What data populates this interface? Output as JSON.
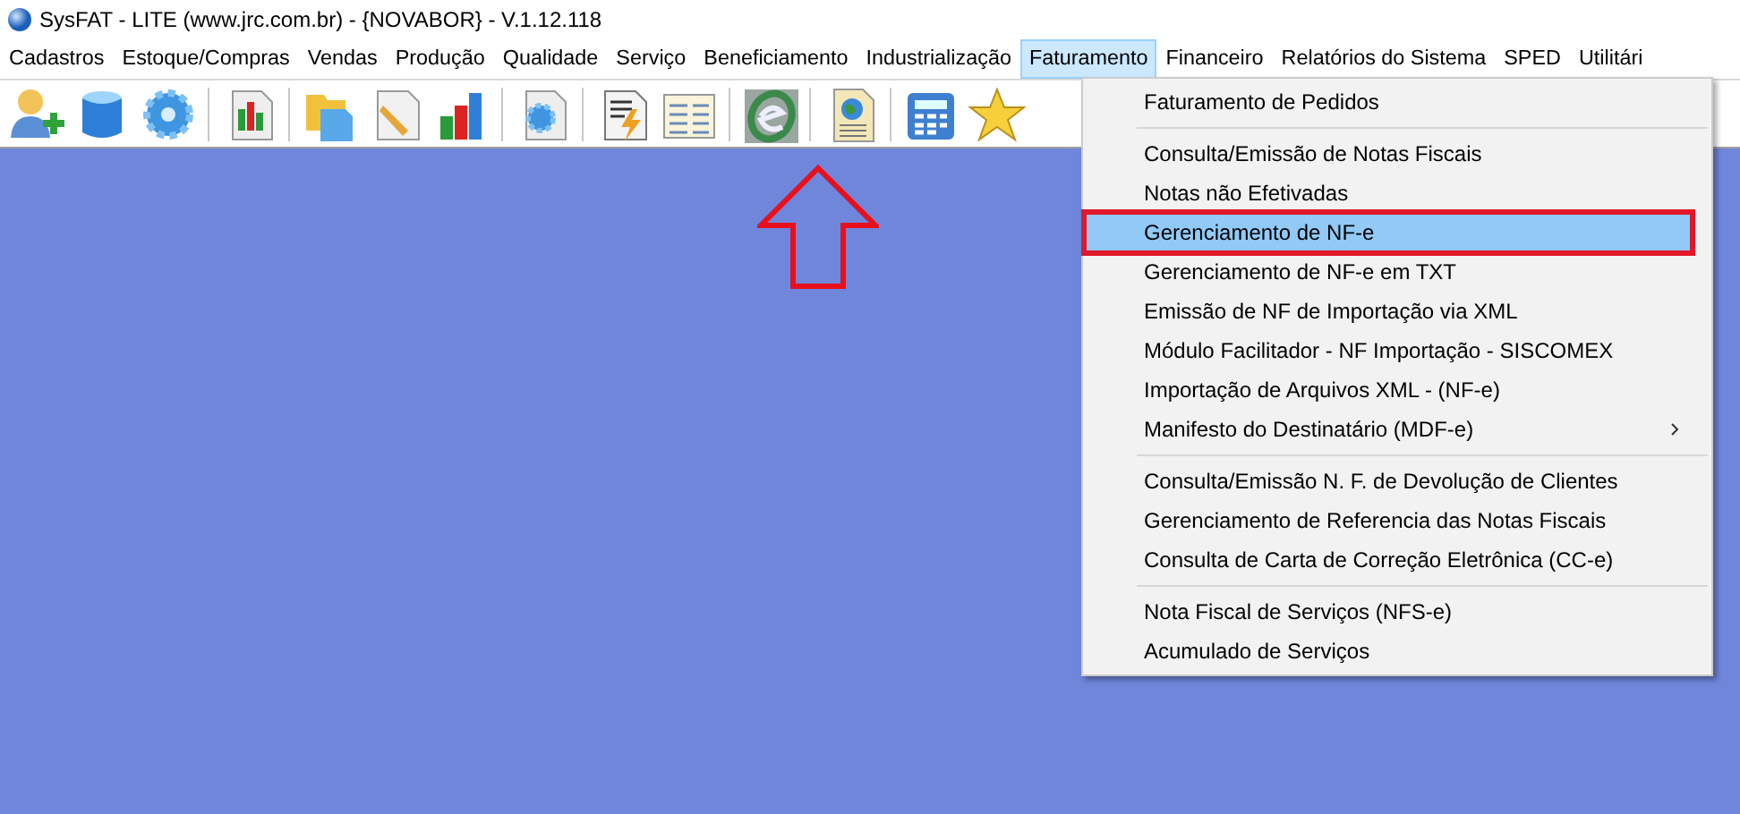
{
  "window": {
    "title": "SysFAT - LITE (www.jrc.com.br) - {NOVABOR} - V.1.12.118"
  },
  "menu_bar": [
    {
      "label": "Cadastros",
      "selected": false
    },
    {
      "label": "Estoque/Compras",
      "selected": false
    },
    {
      "label": "Vendas",
      "selected": false
    },
    {
      "label": "Produção",
      "selected": false
    },
    {
      "label": "Qualidade",
      "selected": false
    },
    {
      "label": "Serviço",
      "selected": false
    },
    {
      "label": "Beneficiamento",
      "selected": false
    },
    {
      "label": "Industrialização",
      "selected": false
    },
    {
      "label": "Faturamento",
      "selected": true
    },
    {
      "label": "Financeiro",
      "selected": false
    },
    {
      "label": "Relatórios do Sistema",
      "selected": false
    },
    {
      "label": "SPED",
      "selected": false
    },
    {
      "label": "Utilitári",
      "selected": false
    }
  ],
  "dropdown": [
    {
      "kind": "item",
      "label": "Faturamento de Pedidos",
      "selected": false,
      "submenu": false
    },
    {
      "kind": "separator"
    },
    {
      "kind": "item",
      "label": "Consulta/Emissão de Notas Fiscais",
      "selected": false,
      "submenu": false
    },
    {
      "kind": "item",
      "label": "Notas não Efetivadas",
      "selected": false,
      "submenu": false
    },
    {
      "kind": "item",
      "label": "Gerenciamento de NF-e",
      "selected": true,
      "submenu": false
    },
    {
      "kind": "item",
      "label": "Gerenciamento de NF-e em TXT",
      "selected": false,
      "submenu": false
    },
    {
      "kind": "item",
      "label": "Emissão de NF de Importação via XML",
      "selected": false,
      "submenu": false
    },
    {
      "kind": "item",
      "label": "Módulo Facilitador - NF Importação - SISCOMEX",
      "selected": false,
      "submenu": false
    },
    {
      "kind": "item",
      "label": "Importação de Arquivos XML - (NF-e)",
      "selected": false,
      "submenu": false
    },
    {
      "kind": "item",
      "label": "Manifesto do Destinatário (MDF-e)",
      "selected": false,
      "submenu": true
    },
    {
      "kind": "separator"
    },
    {
      "kind": "item",
      "label": "Consulta/Emissão N. F. de Devolução de Clientes",
      "selected": false,
      "submenu": false
    },
    {
      "kind": "item",
      "label": "Gerenciamento de Referencia das Notas Fiscais",
      "selected": false,
      "submenu": false
    },
    {
      "kind": "item",
      "label": "Consulta de Carta de Correção Eletrônica (CC-e)",
      "selected": false,
      "submenu": false
    },
    {
      "kind": "separator"
    },
    {
      "kind": "item",
      "label": "Nota Fiscal de Serviços (NFS-e)",
      "selected": false,
      "submenu": false
    },
    {
      "kind": "item",
      "label": "Acumulado de Serviços",
      "selected": false,
      "submenu": false
    }
  ]
}
